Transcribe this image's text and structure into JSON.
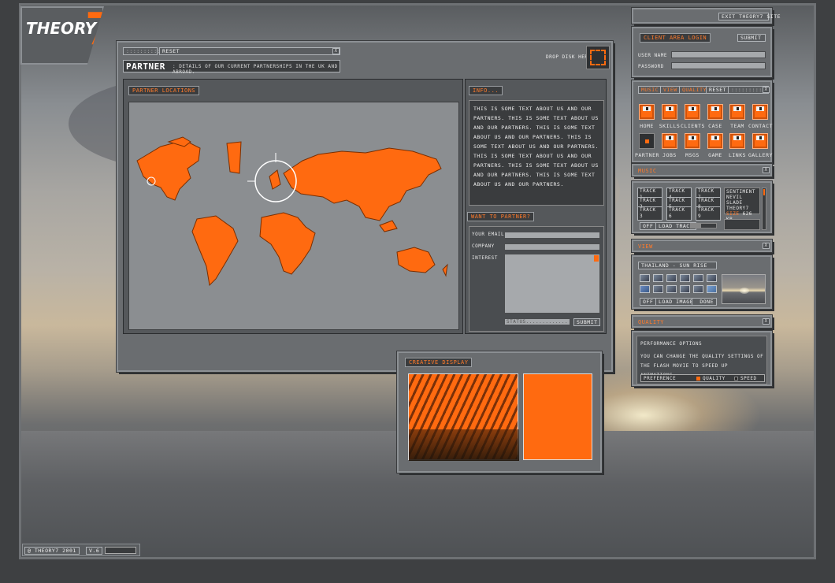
{
  "logo": {
    "text": "THEORY",
    "seven": "7"
  },
  "main": {
    "grip": "::::::::::",
    "reset": "RESET",
    "close": "X",
    "title": "PARTNER",
    "subtitle": ": DETAILS OF OUR CURRENT PARTNERSHIPS IN THE UK AND ABROAD.",
    "drop": "DROP DISK HERE",
    "map_label": "PARTNER LOCATIONS",
    "info_label": "INFO...",
    "info_text": "THIS IS SOME TEXT ABOUT US AND OUR PARTNERS.  THIS IS SOME TEXT ABOUT US AND OUR PARTNERS.  THIS IS SOME TEXT ABOUT US AND OUR PARTNERS.  THIS IS SOME TEXT ABOUT US AND OUR PARTNERS.  THIS IS SOME TEXT ABOUT US AND OUR PARTNERS.  THIS IS SOME TEXT ABOUT US AND OUR PARTNERS.  THIS IS SOME TEXT ABOUT US AND OUR PARTNERS.",
    "partner_label": "WANT TO PARTNER?",
    "email": "YOUR EMAIL",
    "company": "COMPANY",
    "interest": "INTEREST",
    "status": "STATUS.............",
    "submit": "SUBMIT"
  },
  "creative": {
    "label": "CREATIVE DISPLAY"
  },
  "side": {
    "exit": "EXIT THEORY7 SITE",
    "login_label": "CLIENT AREA LOGIN",
    "submit": "SUBMIT",
    "user": "USER NAME",
    "pass": "PASSWORD",
    "tabs": [
      "MUSIC",
      "VIEW",
      "QUALITY",
      "RESET"
    ],
    "grip": "::::::::::",
    "close": "X",
    "nav": [
      "HOME",
      "SKILLS",
      "CLIENTS",
      "CASE",
      "TEAM",
      "CONTACT",
      "PARTNER",
      "JOBS",
      "MSGS",
      "GAME",
      "LINKS",
      "GALLERY"
    ],
    "music_label": "MUSIC",
    "tracks": [
      "TRACK 1",
      "TRACK 4",
      "TRACK 7",
      "TRACK 2",
      "TRACK 5",
      "TRACK 8",
      "TRACK 3",
      "TRACK 6",
      "TRACK 9"
    ],
    "now1": "SENTIMENT",
    "now2": "NEVIL SLADE",
    "now3": "THEORY7",
    "size_k": "SIZE",
    "size_v": "626 KB",
    "off": "OFF",
    "load_track": "LOAD TRACK",
    "view_label": "VIEW",
    "view_title": "THAILAND - SUN RISE",
    "load_image": "LOAD IMAGE",
    "done": "DONE",
    "quality_label": "QUALITY",
    "perf": "PERFORMANCE OPTIONS",
    "perf_text": "YOU CAN CHANGE THE QUALITY SETTINGS OF THE FLASH MOVIE TO SPEED UP ANIMATIONS.",
    "pref": "PREFERENCE",
    "q": "QUALITY",
    "speed": "SPEED"
  },
  "footer": {
    "copy": "@ THEORY7 2001",
    "ver": "V.6"
  },
  "colors": {
    "accent": "#ff6a10"
  }
}
